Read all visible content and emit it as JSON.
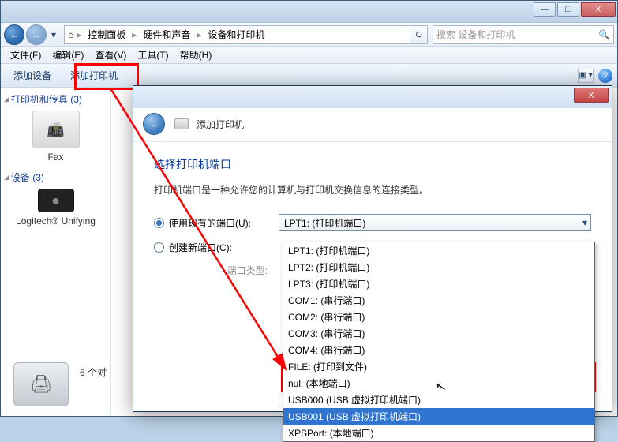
{
  "titlebar": {
    "min": "—",
    "max": "☐",
    "close": "X"
  },
  "nav": {
    "back": "←",
    "fwd": "→"
  },
  "breadcrumb": {
    "root_icon": "⌂",
    "p2": "控制面板",
    "p3": "硬件和声音",
    "p4": "设备和打印机"
  },
  "search": {
    "placeholder": "搜索 设备和打印机",
    "icon": "🔍"
  },
  "menu": {
    "file": "文件(F)",
    "edit": "编辑(E)",
    "view": "查看(V)",
    "tools": "工具(T)",
    "help": "帮助(H)"
  },
  "toolbar": {
    "add_device": "添加设备",
    "add_printer": "添加打印机"
  },
  "sidebar": {
    "group1": {
      "title": "打印机和传真 (3)",
      "item": "Fax"
    },
    "group2": {
      "title": "设备 (3)",
      "item": "Logitech® Unifying"
    }
  },
  "mainpane": {
    "partial": "6 个对"
  },
  "dialog": {
    "title": "添加打印机",
    "heading": "选择打印机端口",
    "desc": "打印机端口是一种允许您的计算机与打印机交换信息的连接类型。",
    "use_existing": "使用现有的端口(U):",
    "create_new": "创建新端口(C):",
    "port_type_label": "端口类型:",
    "selected": "LPT1: (打印机端口)",
    "options": [
      "LPT1: (打印机端口)",
      "LPT2: (打印机端口)",
      "LPT3: (打印机端口)",
      "COM1: (串行端口)",
      "COM2: (串行端口)",
      "COM3: (串行端口)",
      "COM4: (串行端口)",
      "FILE: (打印到文件)",
      "nul: (本地端口)",
      "USB000 (USB 虚拟打印机端口)",
      "USB001 (USB 虚拟打印机端口)",
      "XPSPort: (本地端口)"
    ],
    "highlight_index": 10
  }
}
